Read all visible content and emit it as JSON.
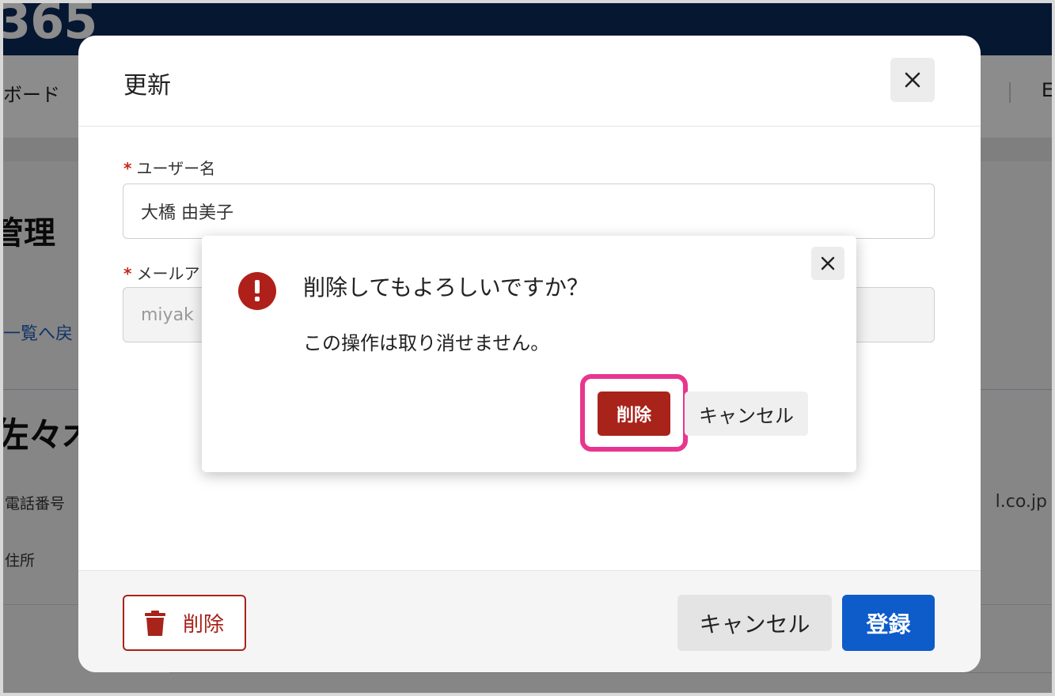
{
  "background": {
    "logo": "365",
    "nav_item": "ボード",
    "nav_right": "E",
    "page_title": "管理",
    "back_link": "一覧へ戻",
    "person_name": "佐々木",
    "label_phone": "電話番号",
    "label_address": "住所",
    "email_tail": "l.co.jp"
  },
  "update_modal": {
    "title": "更新",
    "close_icon": "close-icon",
    "fields": {
      "username_label": "ユーザー名",
      "username_value": "大橋 由美子",
      "email_label": "メールア",
      "email_value": "miyak"
    },
    "required_mark": "*",
    "footer": {
      "delete_label": "削除",
      "cancel_label": "キャンセル",
      "register_label": "登録"
    }
  },
  "confirm_dialog": {
    "icon": "exclamation-circle-icon",
    "title": "削除してもよろしいですか？",
    "message": "この操作は取り消せません。",
    "delete_label": "削除",
    "cancel_label": "キャンセル"
  },
  "colors": {
    "header_navy": "#0b2a5b",
    "danger": "#a8231a",
    "primary": "#0d5cc9",
    "highlight": "#e8368f"
  }
}
